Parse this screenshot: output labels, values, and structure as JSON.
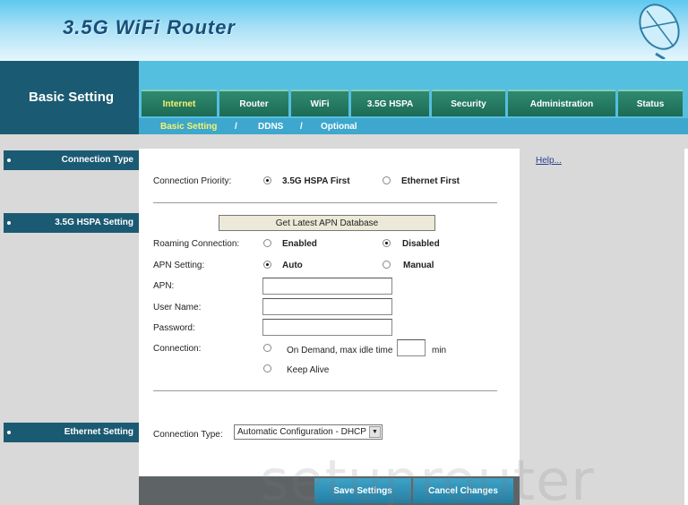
{
  "header": {
    "title": "3.5G WiFi Router"
  },
  "page_title": "Basic Setting",
  "tabs": [
    {
      "label": "Internet",
      "active": true
    },
    {
      "label": "Router"
    },
    {
      "label": "WiFi"
    },
    {
      "label": "3.5G HSPA"
    },
    {
      "label": "Security"
    },
    {
      "label": "Administration"
    },
    {
      "label": "Status"
    }
  ],
  "subnav": {
    "item1": "Basic Setting",
    "sep": "/",
    "item2": "DDNS",
    "item3": "Optional"
  },
  "sidebar": {
    "connection_type": "Connection Type",
    "hspa_setting": "3.5G HSPA Setting",
    "ethernet_setting": "Ethernet Setting"
  },
  "help_link": "Help...",
  "form": {
    "connection_priority_label": "Connection Priority:",
    "priority_opt1": "3.5G HSPA First",
    "priority_opt2": "Ethernet First",
    "apn_button": "Get Latest APN Database",
    "roaming_label": "Roaming Connection:",
    "roaming_opt1": "Enabled",
    "roaming_opt2": "Disabled",
    "apn_setting_label": "APN Setting:",
    "apn_opt1": "Auto",
    "apn_opt2": "Manual",
    "apn_label": "APN:",
    "apn_value": "",
    "username_label": "User Name:",
    "username_value": "",
    "password_label": "Password:",
    "password_value": "",
    "connection_label": "Connection:",
    "conn_opt1": "On Demand, max idle time",
    "idle_value": "",
    "idle_unit": "min",
    "conn_opt2": "Keep Alive",
    "conn_type_label": "Connection Type:",
    "conn_type_value": "Automatic Configuration - DHCP"
  },
  "buttons": {
    "save": "Save Settings",
    "cancel": "Cancel Changes"
  },
  "watermark": "setuprouter"
}
